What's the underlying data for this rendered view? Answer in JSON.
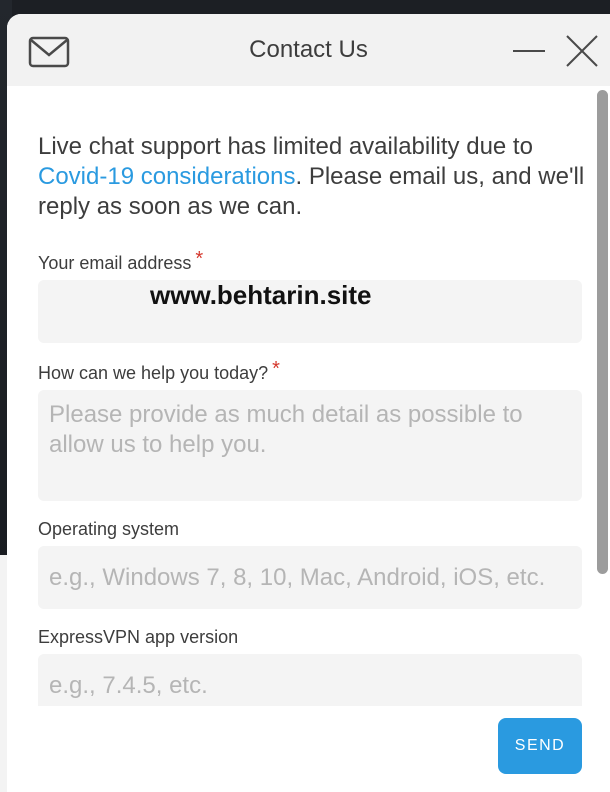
{
  "header": {
    "title": "Contact Us",
    "icons": [
      "mail-icon",
      "minimize-icon",
      "close-icon"
    ]
  },
  "intro": {
    "text_before": "Live chat support has limited availability due to ",
    "link": "Covid-19 considerations",
    "text_after": ". Please email us, and we'll reply as soon as we can."
  },
  "form": {
    "email": {
      "label": "Your email address",
      "required": "*",
      "value": ""
    },
    "help": {
      "label": "How can we help you today?",
      "required": "*",
      "placeholder": "Please provide as much detail as possible to allow us to help you."
    },
    "os": {
      "label": "Operating system",
      "placeholder": "e.g., Windows 7, 8, 10, Mac, Android, iOS, etc."
    },
    "app_version": {
      "label": "ExpressVPN app version",
      "placeholder": "e.g., 7.4.5, etc."
    }
  },
  "watermark": "www.behtarin.site",
  "send_label": "SEND",
  "colors": {
    "accent": "#2a9ae0",
    "required": "#d4372c",
    "field_bg": "#f4f4f4",
    "header_bg": "#f2f2f2"
  }
}
